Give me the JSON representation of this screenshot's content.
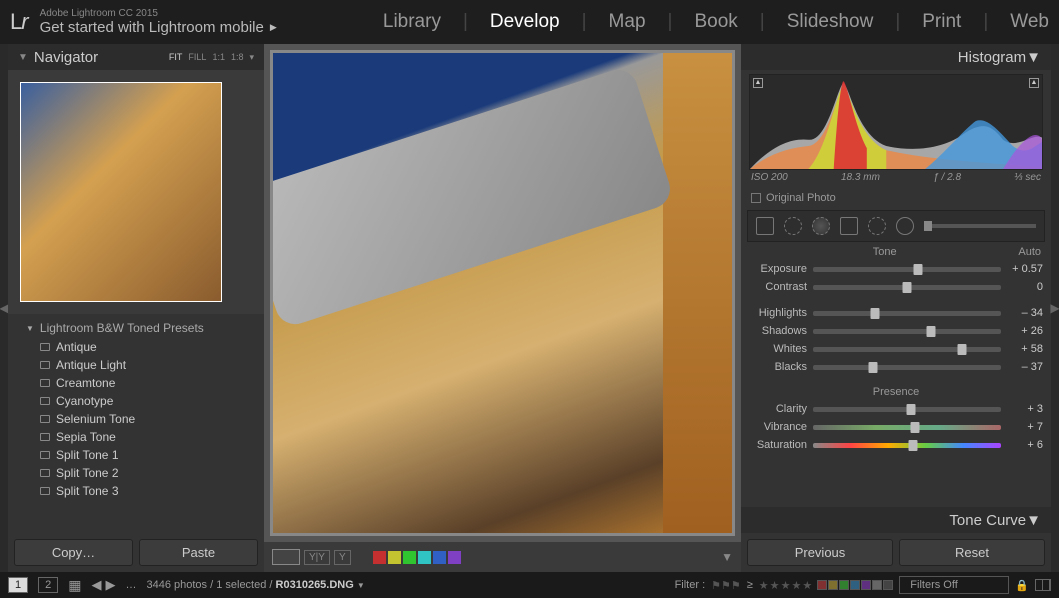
{
  "titlebar": {
    "logo_l": "L",
    "logo_r": "r",
    "version": "Adobe Lightroom CC 2015",
    "subtitle": "Get started with Lightroom mobile",
    "arrow": "▶"
  },
  "modules": {
    "library": "Library",
    "develop": "Develop",
    "map": "Map",
    "book": "Book",
    "slideshow": "Slideshow",
    "print": "Print",
    "web": "Web"
  },
  "navigator": {
    "title": "Navigator",
    "zoom_fit": "FIT",
    "zoom_fill": "FILL",
    "zoom_11": "1:1",
    "zoom_18": "1:8"
  },
  "presets": {
    "group_title": "Lightroom B&W Toned Presets",
    "items": [
      "Antique",
      "Antique Light",
      "Creamtone",
      "Cyanotype",
      "Selenium Tone",
      "Sepia Tone",
      "Split Tone 1",
      "Split Tone 2",
      "Split Tone 3"
    ]
  },
  "left_buttons": {
    "copy": "Copy…",
    "paste": "Paste"
  },
  "histogram": {
    "title": "Histogram",
    "iso": "ISO 200",
    "focal": "18.3 mm",
    "aperture": "ƒ / 2.8",
    "shutter": "⅓ sec",
    "original": "Original Photo"
  },
  "basic": {
    "tone_label": "Tone",
    "auto_label": "Auto",
    "presence_label": "Presence",
    "sliders": {
      "exposure": {
        "label": "Exposure",
        "value": "+ 0.57",
        "pos": 56
      },
      "contrast": {
        "label": "Contrast",
        "value": "0",
        "pos": 50
      },
      "highlights": {
        "label": "Highlights",
        "value": "– 34",
        "pos": 33
      },
      "shadows": {
        "label": "Shadows",
        "value": "+ 26",
        "pos": 63
      },
      "whites": {
        "label": "Whites",
        "value": "+ 58",
        "pos": 79
      },
      "blacks": {
        "label": "Blacks",
        "value": "– 37",
        "pos": 32
      },
      "clarity": {
        "label": "Clarity",
        "value": "+ 3",
        "pos": 52
      },
      "vibrance": {
        "label": "Vibrance",
        "value": "+ 7",
        "pos": 54
      },
      "saturation": {
        "label": "Saturation",
        "value": "+ 6",
        "pos": 53
      }
    }
  },
  "tone_curve": {
    "title": "Tone Curve"
  },
  "right_buttons": {
    "previous": "Previous",
    "reset": "Reset"
  },
  "swatch_colors": [
    "#c43030",
    "#c4c430",
    "#30c430",
    "#30c4c4",
    "#3060c4",
    "#8040c4"
  ],
  "bottombar": {
    "page1": "1",
    "page2": "2",
    "ellipsis": "…",
    "info": "3446 photos / 1 selected /",
    "filename": "R0310265.DNG",
    "filter_label": "Filter :",
    "geq": "≥",
    "filters_off": "Filters Off",
    "label_colors": [
      "#803030",
      "#807030",
      "#308030",
      "#306080",
      "#603080",
      "#666",
      "#444"
    ]
  }
}
